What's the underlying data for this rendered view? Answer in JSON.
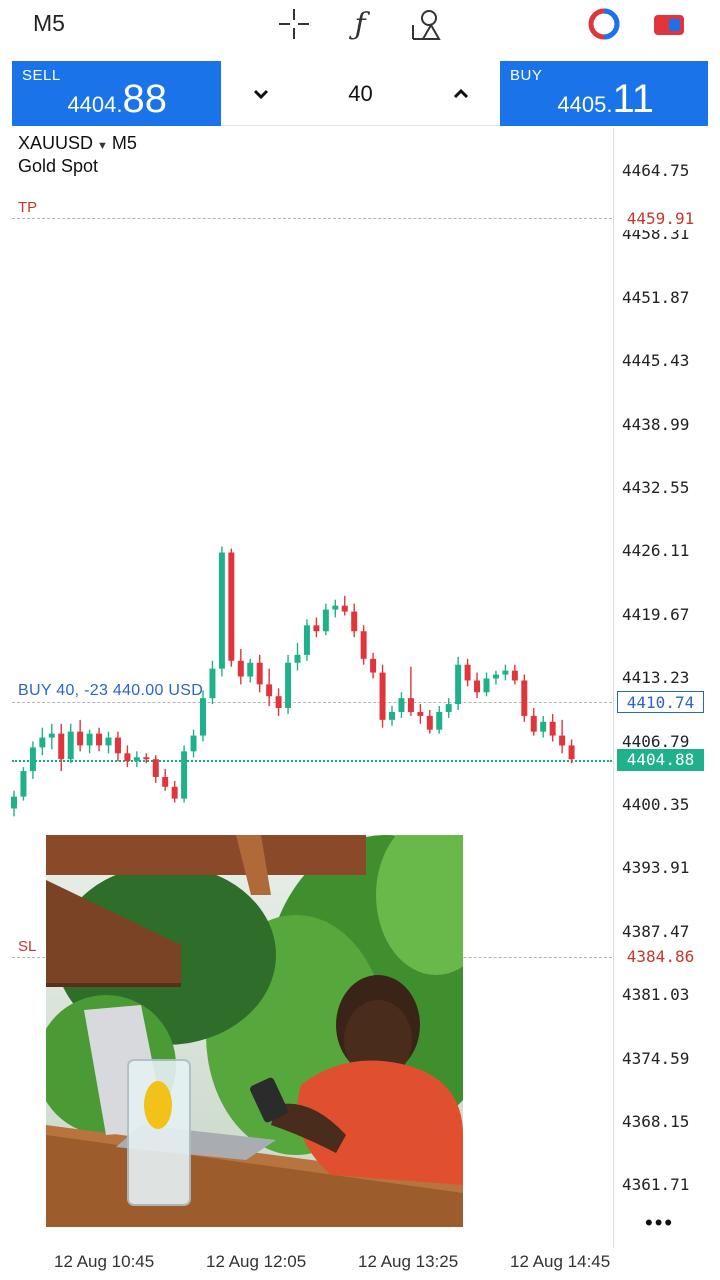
{
  "toolbar": {
    "timeframe": "M5",
    "icons": [
      "crosshair-icon",
      "indicators-icon",
      "objects-icon",
      "chart-toggle-icon",
      "trade-toggle-icon"
    ]
  },
  "trade": {
    "sell_label": "SELL",
    "sell_price_prefix": "4404.",
    "sell_price_big": "88",
    "buy_label": "BUY",
    "buy_price_prefix": "4405.",
    "buy_price_big": "11",
    "volume": "40"
  },
  "chart": {
    "symbol": "XAUUSD",
    "timeframe": "M5",
    "description": "Gold Spot",
    "price_ticks": [
      "4464.75",
      "4458.31",
      "4451.87",
      "4445.43",
      "4438.99",
      "4432.55",
      "4426.11",
      "4419.67",
      "4413.23",
      "4406.79",
      "4400.35",
      "4393.91",
      "4387.47",
      "4381.03",
      "4374.59",
      "4368.15",
      "4361.71"
    ],
    "time_ticks": [
      "12 Aug 10:45",
      "12 Aug 12:05",
      "12 Aug 13:25",
      "12 Aug 14:45"
    ],
    "tp_label": "TP",
    "tp_price": "4459.91",
    "sl_label": "SL",
    "sl_price": "4384.86",
    "order_label": "BUY 40, -23 440.00 USD",
    "order_price": "4410.74",
    "bid_price": "4404.88",
    "more": "•••",
    "colors": {
      "up": "#1fb28a",
      "down": "#e0353b",
      "accent": "#1a73e8"
    }
  },
  "chart_data": {
    "type": "candlestick",
    "candles": [
      {
        "o": 4400.0,
        "h": 4401.8,
        "l": 4399.2,
        "c": 4401.2
      },
      {
        "o": 4401.2,
        "h": 4404.2,
        "l": 4400.8,
        "c": 4403.8
      },
      {
        "o": 4403.8,
        "h": 4406.8,
        "l": 4403.0,
        "c": 4406.2
      },
      {
        "o": 4406.2,
        "h": 4408.2,
        "l": 4405.4,
        "c": 4407.2
      },
      {
        "o": 4407.2,
        "h": 4408.6,
        "l": 4406.0,
        "c": 4407.6
      },
      {
        "o": 4407.6,
        "h": 4408.6,
        "l": 4403.8,
        "c": 4405.0
      },
      {
        "o": 4405.0,
        "h": 4408.6,
        "l": 4404.6,
        "c": 4407.8
      },
      {
        "o": 4407.8,
        "h": 4409.0,
        "l": 4405.8,
        "c": 4406.4
      },
      {
        "o": 4406.4,
        "h": 4408.0,
        "l": 4405.6,
        "c": 4407.6
      },
      {
        "o": 4407.6,
        "h": 4408.2,
        "l": 4405.8,
        "c": 4406.4
      },
      {
        "o": 4406.4,
        "h": 4407.8,
        "l": 4405.6,
        "c": 4407.2
      },
      {
        "o": 4407.2,
        "h": 4407.8,
        "l": 4404.8,
        "c": 4405.6
      },
      {
        "o": 4405.6,
        "h": 4406.4,
        "l": 4404.2,
        "c": 4404.8
      },
      {
        "o": 4404.8,
        "h": 4405.8,
        "l": 4404.2,
        "c": 4405.2
      },
      {
        "o": 4405.2,
        "h": 4405.6,
        "l": 4404.6,
        "c": 4405.0
      },
      {
        "o": 4405.0,
        "h": 4405.4,
        "l": 4402.6,
        "c": 4403.2
      },
      {
        "o": 4403.2,
        "h": 4404.0,
        "l": 4401.8,
        "c": 4402.2
      },
      {
        "o": 4402.2,
        "h": 4402.8,
        "l": 4400.6,
        "c": 4401.0
      },
      {
        "o": 4401.0,
        "h": 4406.4,
        "l": 4400.6,
        "c": 4405.8
      },
      {
        "o": 4405.8,
        "h": 4408.0,
        "l": 4405.2,
        "c": 4407.4
      },
      {
        "o": 4407.4,
        "h": 4412.0,
        "l": 4406.8,
        "c": 4411.2
      },
      {
        "o": 4411.2,
        "h": 4415.0,
        "l": 4410.6,
        "c": 4414.2
      },
      {
        "o": 4414.2,
        "h": 4426.6,
        "l": 4413.4,
        "c": 4426.0
      },
      {
        "o": 4426.0,
        "h": 4426.4,
        "l": 4414.4,
        "c": 4415.0
      },
      {
        "o": 4415.0,
        "h": 4416.2,
        "l": 4412.6,
        "c": 4413.4
      },
      {
        "o": 4413.4,
        "h": 4415.2,
        "l": 4412.8,
        "c": 4414.8
      },
      {
        "o": 4414.8,
        "h": 4415.6,
        "l": 4411.8,
        "c": 4412.6
      },
      {
        "o": 4412.6,
        "h": 4414.2,
        "l": 4410.4,
        "c": 4411.4
      },
      {
        "o": 4411.4,
        "h": 4412.2,
        "l": 4409.4,
        "c": 4410.2
      },
      {
        "o": 4410.2,
        "h": 4415.6,
        "l": 4409.6,
        "c": 4414.8
      },
      {
        "o": 4414.8,
        "h": 4416.8,
        "l": 4414.0,
        "c": 4415.6
      },
      {
        "o": 4415.6,
        "h": 4419.2,
        "l": 4415.0,
        "c": 4418.6
      },
      {
        "o": 4418.6,
        "h": 4419.4,
        "l": 4417.4,
        "c": 4418.0
      },
      {
        "o": 4418.0,
        "h": 4420.8,
        "l": 4417.6,
        "c": 4420.2
      },
      {
        "o": 4420.2,
        "h": 4421.2,
        "l": 4419.4,
        "c": 4420.6
      },
      {
        "o": 4420.6,
        "h": 4421.6,
        "l": 4419.6,
        "c": 4420.0
      },
      {
        "o": 4420.0,
        "h": 4420.8,
        "l": 4417.4,
        "c": 4418.0
      },
      {
        "o": 4418.0,
        "h": 4418.6,
        "l": 4414.6,
        "c": 4415.2
      },
      {
        "o": 4415.2,
        "h": 4415.8,
        "l": 4413.2,
        "c": 4413.8
      },
      {
        "o": 4413.8,
        "h": 4414.6,
        "l": 4408.2,
        "c": 4409.0
      },
      {
        "o": 4409.0,
        "h": 4410.4,
        "l": 4408.4,
        "c": 4409.8
      },
      {
        "o": 4409.8,
        "h": 4411.8,
        "l": 4409.2,
        "c": 4411.2
      },
      {
        "o": 4411.2,
        "h": 4414.4,
        "l": 4409.4,
        "c": 4409.8
      },
      {
        "o": 4409.8,
        "h": 4410.6,
        "l": 4408.6,
        "c": 4409.4
      },
      {
        "o": 4409.4,
        "h": 4410.0,
        "l": 4407.6,
        "c": 4408.0
      },
      {
        "o": 4408.0,
        "h": 4410.4,
        "l": 4407.6,
        "c": 4409.8
      },
      {
        "o": 4409.8,
        "h": 4411.2,
        "l": 4409.2,
        "c": 4410.6
      },
      {
        "o": 4410.6,
        "h": 4415.4,
        "l": 4410.0,
        "c": 4414.6
      },
      {
        "o": 4414.6,
        "h": 4415.2,
        "l": 4412.4,
        "c": 4413.0
      },
      {
        "o": 4413.0,
        "h": 4413.8,
        "l": 4411.2,
        "c": 4411.8
      },
      {
        "o": 4411.8,
        "h": 4413.8,
        "l": 4411.4,
        "c": 4413.2
      },
      {
        "o": 4413.2,
        "h": 4414.0,
        "l": 4412.6,
        "c": 4413.6
      },
      {
        "o": 4413.6,
        "h": 4414.6,
        "l": 4413.0,
        "c": 4414.0
      },
      {
        "o": 4414.0,
        "h": 4414.6,
        "l": 4412.6,
        "c": 4413.0
      },
      {
        "o": 4413.0,
        "h": 4413.6,
        "l": 4408.8,
        "c": 4409.4
      },
      {
        "o": 4409.4,
        "h": 4410.2,
        "l": 4407.4,
        "c": 4407.8
      },
      {
        "o": 4407.8,
        "h": 4409.4,
        "l": 4407.2,
        "c": 4408.8
      },
      {
        "o": 4408.8,
        "h": 4409.6,
        "l": 4406.8,
        "c": 4407.4
      },
      {
        "o": 4407.4,
        "h": 4409.0,
        "l": 4405.6,
        "c": 4406.4
      },
      {
        "o": 4406.4,
        "h": 4407.0,
        "l": 4404.6,
        "c": 4405.0
      }
    ],
    "ylim": [
      4358.5,
      4467.0
    ]
  }
}
